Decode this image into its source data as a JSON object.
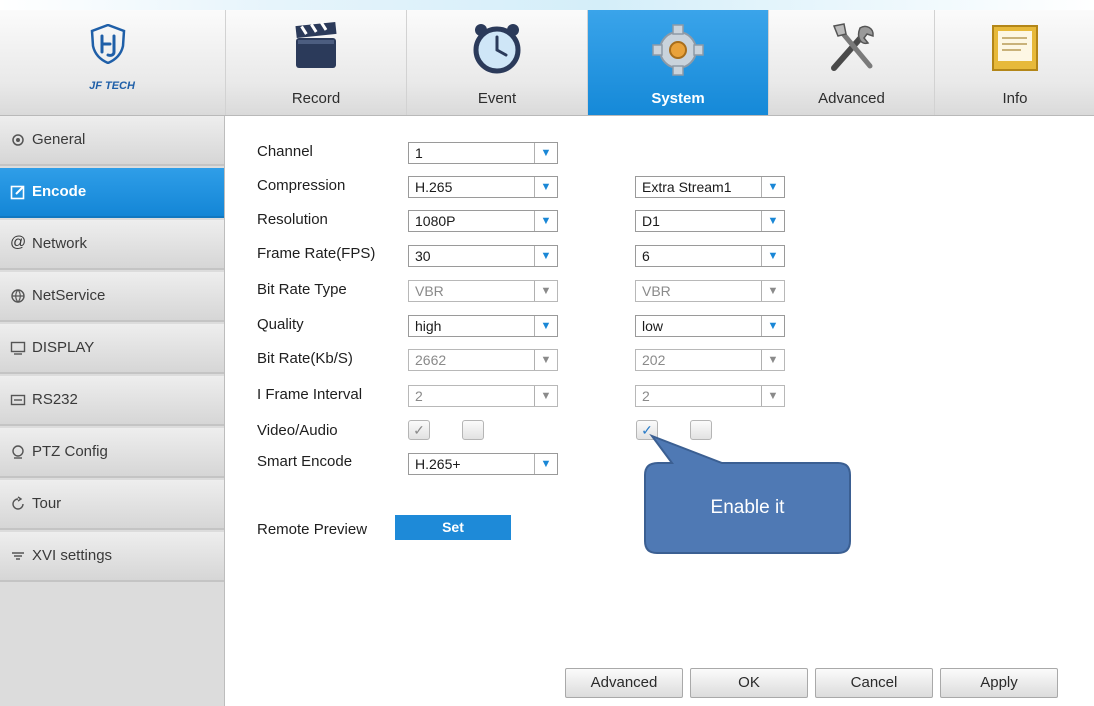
{
  "logo": {
    "text": "JF TECH"
  },
  "nav": {
    "tabs": [
      {
        "label": "Record",
        "icon": "clapperboard-icon"
      },
      {
        "label": "Event",
        "icon": "alarm-clock-icon"
      },
      {
        "label": "System",
        "icon": "gear-icon",
        "active": true
      },
      {
        "label": "Advanced",
        "icon": "tools-icon"
      },
      {
        "label": "Info",
        "icon": "info-panel-icon"
      }
    ]
  },
  "sidebar": {
    "items": [
      {
        "label": "General",
        "icon": "gear-small-icon"
      },
      {
        "label": "Encode",
        "icon": "edit-icon",
        "active": true
      },
      {
        "label": "Network",
        "icon": "at-icon"
      },
      {
        "label": "NetService",
        "icon": "globe-icon"
      },
      {
        "label": "DISPLAY",
        "icon": "monitor-icon"
      },
      {
        "label": "RS232",
        "icon": "serial-port-icon"
      },
      {
        "label": "PTZ Config",
        "icon": "ptz-icon"
      },
      {
        "label": "Tour",
        "icon": "tour-icon"
      },
      {
        "label": "XVI settings",
        "icon": "xvi-icon"
      }
    ]
  },
  "form": {
    "labels": {
      "channel": "Channel",
      "compression": "Compression",
      "resolution": "Resolution",
      "frame_rate": "Frame Rate(FPS)",
      "bit_rate_type": "Bit Rate Type",
      "quality": "Quality",
      "bit_rate": "Bit Rate(Kb/S)",
      "iframe": "I Frame Interval",
      "video_audio": "Video/Audio",
      "smart_encode": "Smart Encode",
      "remote_preview": "Remote Preview"
    },
    "main_stream": {
      "channel": "1",
      "compression": "H.265",
      "resolution": "1080P",
      "frame_rate": "30",
      "bit_rate_type": "VBR",
      "quality": "high",
      "bit_rate": "2662",
      "iframe": "2",
      "video_checked": true,
      "audio_checked": false,
      "smart_encode": "H.265+"
    },
    "extra_stream": {
      "stream": "Extra Stream1",
      "resolution": "D1",
      "frame_rate": "6",
      "bit_rate_type": "VBR",
      "quality": "low",
      "bit_rate": "202",
      "iframe": "2",
      "video_checked": true,
      "audio_checked": false
    },
    "set_label": "Set",
    "dropdown_glyph": "▼",
    "check_glyph": "✓"
  },
  "buttons": {
    "advanced": "Advanced",
    "ok": "OK",
    "cancel": "Cancel",
    "apply": "Apply"
  },
  "callout": {
    "text": "Enable it"
  },
  "colors": {
    "accent": "#1a8ad8",
    "callout": "#4f79b4"
  }
}
